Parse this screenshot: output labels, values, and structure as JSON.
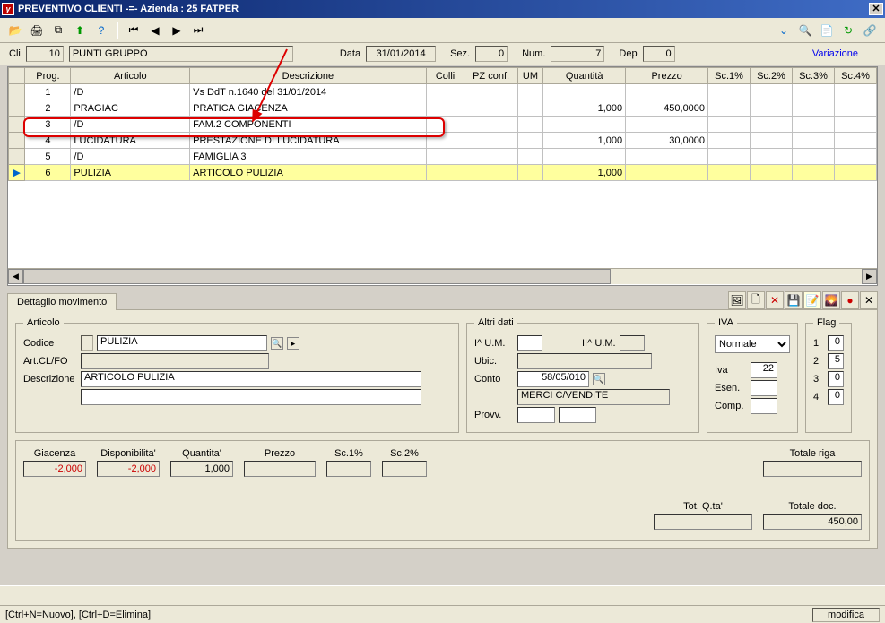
{
  "window": {
    "title": "PREVENTIVO CLIENTI     -=-  Azienda :   25 FATPER"
  },
  "header": {
    "cli_label": "Cli",
    "cli_num": "10",
    "cli_name": "PUNTI GRUPPO",
    "data_label": "Data",
    "data_val": "31/01/2014",
    "sez_label": "Sez.",
    "sez_val": "0",
    "num_label": "Num.",
    "num_val": "7",
    "dep_label": "Dep",
    "dep_val": "0",
    "variazione": "Variazione"
  },
  "grid": {
    "cols": [
      "Prog.",
      "Articolo",
      "Descrizione",
      "Colli",
      "PZ conf.",
      "UM",
      "Quantità",
      "Prezzo",
      "Sc.1%",
      "Sc.2%",
      "Sc.3%",
      "Sc.4%"
    ],
    "rows": [
      {
        "prog": "1",
        "art": "/D",
        "desc": "Vs DdT n.1640 del 31/01/2014",
        "colli": "",
        "pz": "",
        "um": "",
        "qta": "",
        "prz": "",
        "s1": "",
        "s2": "",
        "s3": "",
        "s4": ""
      },
      {
        "prog": "2",
        "art": "PRAGIAC",
        "desc": "PRATICA GIACENZA",
        "colli": "",
        "pz": "",
        "um": "",
        "qta": "1,000",
        "prz": "450,0000",
        "s1": "",
        "s2": "",
        "s3": "",
        "s4": ""
      },
      {
        "prog": "3",
        "art": "/D",
        "desc": "FAM.2 COMPONENTI",
        "colli": "",
        "pz": "",
        "um": "",
        "qta": "",
        "prz": "",
        "s1": "",
        "s2": "",
        "s3": "",
        "s4": "",
        "marked": true
      },
      {
        "prog": "4",
        "art": "LUCIDATURA",
        "desc": "PRESTAZIONE DI LUCIDATURA",
        "colli": "",
        "pz": "",
        "um": "",
        "qta": "1,000",
        "prz": "30,0000",
        "s1": "",
        "s2": "",
        "s3": "",
        "s4": ""
      },
      {
        "prog": "5",
        "art": "/D",
        "desc": "FAMIGLIA 3",
        "colli": "",
        "pz": "",
        "um": "",
        "qta": "",
        "prz": "",
        "s1": "",
        "s2": "",
        "s3": "",
        "s4": ""
      },
      {
        "prog": "6",
        "art": "PULIZIA",
        "desc": "ARTICOLO PULIZIA",
        "colli": "",
        "pz": "",
        "um": "",
        "qta": "1,000",
        "prz": "",
        "s1": "",
        "s2": "",
        "s3": "",
        "s4": "",
        "selected": true
      }
    ]
  },
  "tab": {
    "label": "Dettaglio movimento"
  },
  "articolo": {
    "legend": "Articolo",
    "codice_label": "Codice",
    "codice_val": "PULIZIA",
    "artclfo_label": "Art.CL/FO",
    "artclfo_val": "",
    "desc_label": "Descrizione",
    "desc_val": "ARTICOLO PULIZIA",
    "desc2_val": ""
  },
  "altri": {
    "legend": "Altri dati",
    "ium_label": "I^ U.M.",
    "ium_val": "",
    "iium_label": "II^ U.M.",
    "iium_val": "",
    "ubic_label": "Ubic.",
    "conto_label": "Conto",
    "conto_val": "58/05/010",
    "conto_desc": "MERCI C/VENDITE",
    "provv_label": "Provv.",
    "provv1": "",
    "provv2": ""
  },
  "iva": {
    "legend": "IVA",
    "combo_val": "Normale",
    "iva_label": "Iva",
    "iva_val": "22",
    "esen_label": "Esen.",
    "esen_val": "",
    "comp_label": "Comp.",
    "comp_val": ""
  },
  "flag": {
    "legend": "Flag",
    "f1_label": "1",
    "f1_val": "0",
    "f2_label": "2",
    "f2_val": "5",
    "f3_label": "3",
    "f3_val": "0",
    "f4_label": "4",
    "f4_val": "0"
  },
  "summary": {
    "giac_label": "Giacenza",
    "giac_val": "-2,000",
    "disp_label": "Disponibilita'",
    "disp_val": "-2,000",
    "qta_label": "Quantita'",
    "qta_val": "1,000",
    "prz_label": "Prezzo",
    "prz_val": "",
    "s1_label": "Sc.1%",
    "s1_val": "",
    "s2_label": "Sc.2%",
    "s2_val": "",
    "totriga_label": "Totale riga",
    "totriga_val": "",
    "totqta_label": "Tot. Q.ta'",
    "totqta_val": "",
    "totdoc_label": "Totale doc.",
    "totdoc_val": "450,00"
  },
  "status": {
    "left": "[Ctrl+N=Nuovo], [Ctrl+D=Elimina]",
    "right": "modifica"
  }
}
